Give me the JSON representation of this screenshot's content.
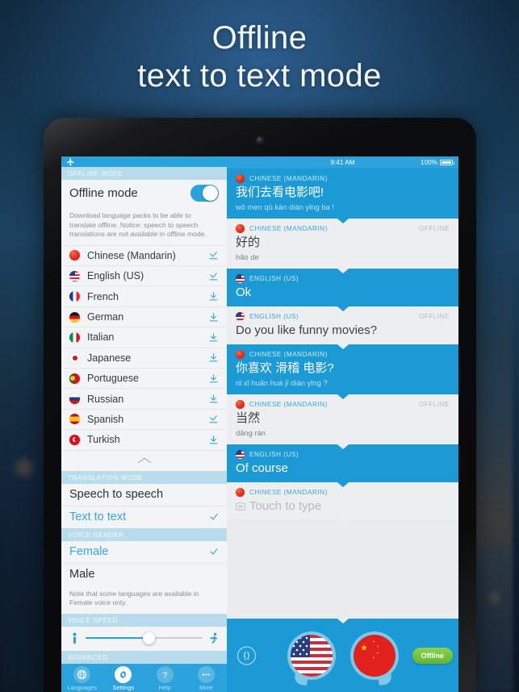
{
  "headline": {
    "line1": "Offline",
    "line2": "text to text mode"
  },
  "left_panel": {
    "status_icon": "airplane-mode-icon",
    "sections": {
      "offline_mode": "OFFLINE MODE",
      "translation_mode": "TRANSLATION MODE",
      "voice_gender": "VOICE GENDER",
      "voice_speed": "VOICE SPEED",
      "advanced": "ADVANCED"
    },
    "offline_mode": {
      "label": "Offline mode",
      "enabled": true,
      "note": "Download language packs to be able to translate offline. Notice: speech to speech translations are not available in offline mode."
    },
    "languages": [
      {
        "name": "Chinese (Mandarin)",
        "flag": "cn",
        "state": "downloaded"
      },
      {
        "name": "English (US)",
        "flag": "us",
        "state": "downloaded"
      },
      {
        "name": "French",
        "flag": "fr",
        "state": "download"
      },
      {
        "name": "German",
        "flag": "de",
        "state": "download"
      },
      {
        "name": "Italian",
        "flag": "it",
        "state": "download"
      },
      {
        "name": "Japanese",
        "flag": "jp",
        "state": "download"
      },
      {
        "name": "Portuguese",
        "flag": "pt",
        "state": "download"
      },
      {
        "name": "Russian",
        "flag": "ru",
        "state": "download"
      },
      {
        "name": "Spanish",
        "flag": "es",
        "state": "downloaded"
      },
      {
        "name": "Turkish",
        "flag": "tr",
        "state": "download"
      }
    ],
    "translation_modes": [
      {
        "label": "Speech to speech",
        "selected": false
      },
      {
        "label": "Text to text",
        "selected": true
      }
    ],
    "voice_genders": [
      {
        "label": "Female",
        "selected": true
      },
      {
        "label": "Male",
        "selected": false
      }
    ],
    "voice_gender_note": "Note that some languages are available in Female voice only.",
    "voice_speed": {
      "value": 52,
      "min_icon": "standing-person-icon",
      "max_icon": "running-person-icon"
    },
    "tabs": [
      {
        "label": "Languages",
        "icon": "globe-icon",
        "active": false
      },
      {
        "label": "Settings",
        "icon": "gear-icon",
        "active": true
      },
      {
        "label": "Help",
        "icon": "question-icon",
        "active": false
      },
      {
        "label": "More",
        "icon": "ellipsis-icon",
        "active": false
      }
    ]
  },
  "chat_panel": {
    "status_bar": {
      "time": "9:41 AM",
      "battery_percent": "100%"
    },
    "messages": [
      {
        "lang": "CHINESE (MANDARIN)",
        "flag": "cn",
        "text": "我们去看电影吧!",
        "pinyin": "wǒ men qù kàn diàn yǐng ba !",
        "style": "blue",
        "offline": ""
      },
      {
        "lang": "CHINESE (MANDARIN)",
        "flag": "cn",
        "text": "好的",
        "pinyin": "hǎo de",
        "style": "grey",
        "offline": "OFFLINE"
      },
      {
        "lang": "ENGLISH (US)",
        "flag": "us",
        "text": "Ok",
        "pinyin": "",
        "style": "blue",
        "offline": ""
      },
      {
        "lang": "ENGLISH (US)",
        "flag": "us",
        "text": "Do you like funny movies?",
        "pinyin": "",
        "style": "grey",
        "offline": "OFFLINE"
      },
      {
        "lang": "CHINESE (MANDARIN)",
        "flag": "cn",
        "text": "你喜欢 滑稽 电影?",
        "pinyin": "nǐ xǐ huān  huá jī  diàn yǐng ?",
        "style": "blue",
        "offline": ""
      },
      {
        "lang": "CHINESE (MANDARIN)",
        "flag": "cn",
        "text": "当然",
        "pinyin": "dāng rán",
        "style": "grey",
        "offline": "OFFLINE"
      },
      {
        "lang": "ENGLISH (US)",
        "flag": "us",
        "text": "Of course",
        "pinyin": "",
        "style": "blue",
        "offline": ""
      },
      {
        "lang": "CHINESE (MANDARIN)",
        "flag": "cn",
        "text": "Touch to type",
        "pinyin": "",
        "style": "grey",
        "offline": "",
        "is_placeholder": true
      }
    ],
    "footer": {
      "swap_icon": "swap-languages-icon",
      "left_flag": "us",
      "right_flag": "cn",
      "status_pill": "Offline"
    }
  }
}
